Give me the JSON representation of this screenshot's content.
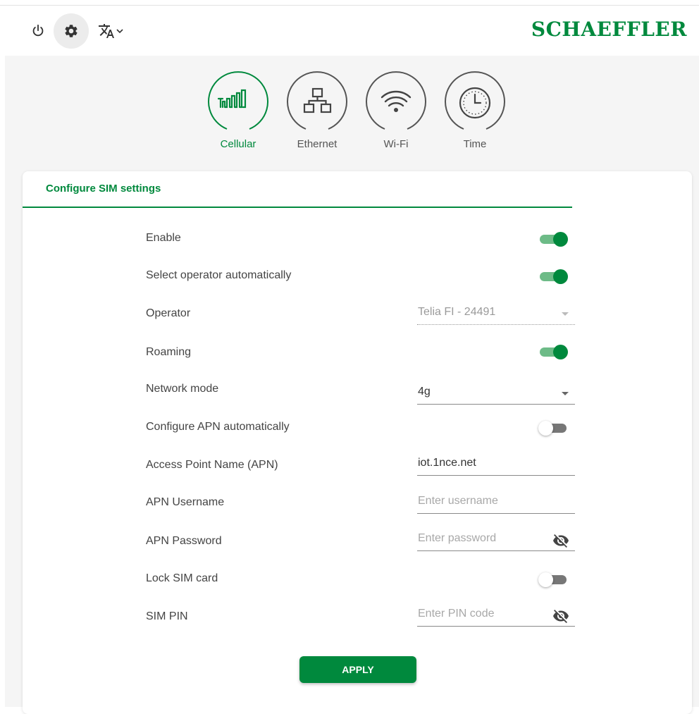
{
  "brand": {
    "name": "SCHAEFFLER",
    "color": "#00893d"
  },
  "topbar": {
    "icons": [
      "power-icon",
      "gear-icon",
      "translate-icon",
      "chevron-down-icon"
    ]
  },
  "tabs": [
    {
      "label": "Cellular",
      "icon": "cellular-signal-icon",
      "active": true
    },
    {
      "label": "Ethernet",
      "icon": "ethernet-network-icon",
      "active": false
    },
    {
      "label": "Wi-Fi",
      "icon": "wifi-icon",
      "active": false
    },
    {
      "label": "Time",
      "icon": "clock-icon",
      "active": false
    }
  ],
  "card": {
    "title": "Configure SIM settings",
    "rows": {
      "enable": {
        "label": "Enable",
        "on": true
      },
      "auto_operator": {
        "label": "Select operator automatically",
        "on": true
      },
      "operator": {
        "label": "Operator",
        "value": "Telia FI - 24491",
        "disabled": true
      },
      "roaming": {
        "label": "Roaming",
        "on": true
      },
      "network_mode": {
        "label": "Network mode",
        "value": "4g"
      },
      "auto_apn": {
        "label": "Configure APN automatically",
        "on": false
      },
      "apn": {
        "label": "Access Point Name (APN)",
        "value": "iot.1nce.net"
      },
      "apn_username": {
        "label": "APN Username",
        "placeholder": "Enter username"
      },
      "apn_password": {
        "label": "APN Password",
        "placeholder": "Enter password",
        "icon": "eye-off-icon"
      },
      "lock_sim": {
        "label": "Lock SIM card",
        "on": false
      },
      "sim_pin": {
        "label": "SIM PIN",
        "placeholder": "Enter PIN code",
        "icon": "eye-off-icon"
      }
    },
    "apply_label": "APPLY"
  }
}
